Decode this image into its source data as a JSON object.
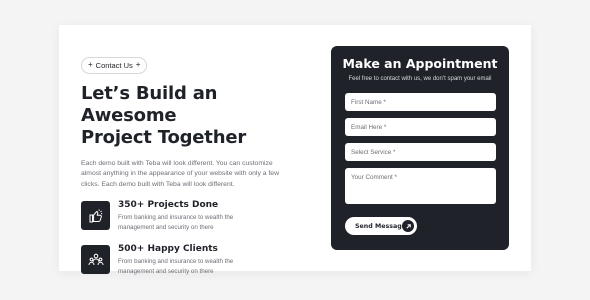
{
  "section": {
    "pill_label": "Contact Us",
    "heading_line1": "Let’s Build an Awesome",
    "heading_line2": "Project Together",
    "description": "Each demo built with Teba will look different. You can customize almost anything in the appearance of your website with only a few clicks. Each demo built with Teba will look different.",
    "features": [
      {
        "icon": "thumbs-up-icon",
        "title": "350+ Projects Done",
        "text": "From banking and insurance to wealth the management and security on there"
      },
      {
        "icon": "team-icon",
        "title": "500+ Happy Clients",
        "text": "From banking and insurance to wealth the management and security on there"
      }
    ]
  },
  "form": {
    "title": "Make an Appointment",
    "subtitle": "Feel free to contact with us, we don’t spam your email",
    "first_name_placeholder": "First Name *",
    "email_placeholder": "Email Here *",
    "service_placeholder": "Select Service *",
    "comment_placeholder": "Your Comment *",
    "send_label": "Send Message"
  },
  "colors": {
    "dark": "#1f2329",
    "muted": "#6b6f76",
    "page_bg": "#f4f4f5"
  }
}
